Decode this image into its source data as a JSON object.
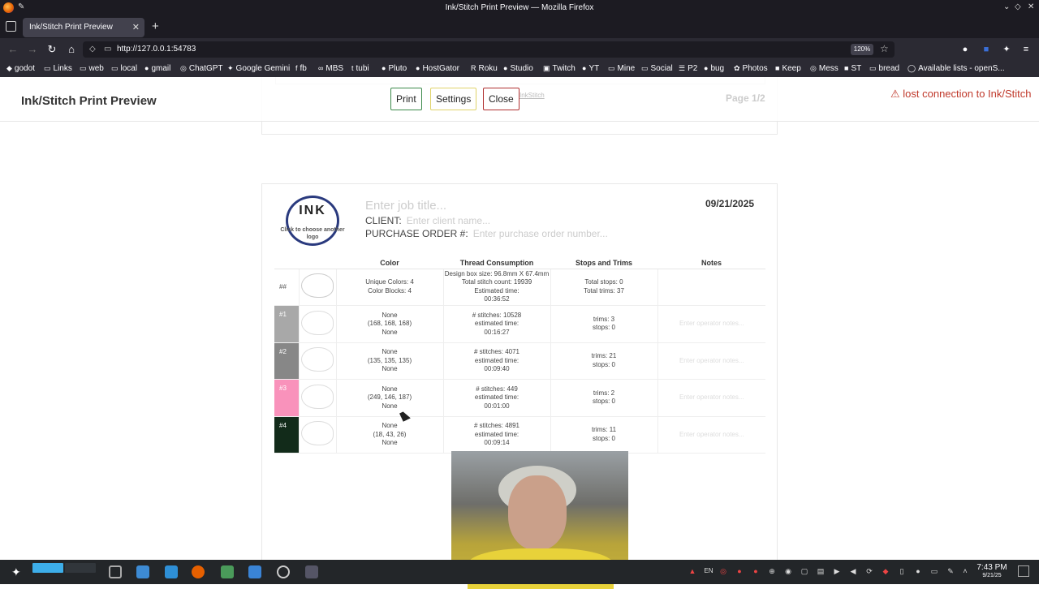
{
  "window": {
    "title": "Ink/Stitch Print Preview — Mozilla Firefox"
  },
  "tab": {
    "label": "Ink/Stitch Print Preview"
  },
  "url": {
    "value": "http://127.0.0.1:54783",
    "zoom": "120%"
  },
  "bookmarks": [
    "godot",
    "Links",
    "web",
    "local",
    "gmail",
    "ChatGPT",
    "Google Gemini",
    "fb",
    "MBS",
    "tubi",
    "Pluto",
    "HostGator",
    "Roku",
    "Studio",
    "Twitch",
    "YT",
    "Mine",
    "Social",
    "P2",
    "bug",
    "Photos",
    "Keep",
    "Mess",
    "ST",
    "bread",
    "Available lists - openS..."
  ],
  "header": {
    "title": "Ink/Stitch Print Preview",
    "print_label": "Print",
    "settings_label": "Settings",
    "close_label": "Close",
    "page_label": "Page 1/2",
    "connection_label": "⚠ lost connection to Ink/Stitch",
    "faint_link": "InkStitch"
  },
  "doc": {
    "logo_text": "INK",
    "logo_caption": "Click to choose another logo",
    "job_title_placeholder": "Enter job title...",
    "client_label": "CLIENT:",
    "client_placeholder": "Enter client name...",
    "po_label": "PURCHASE ORDER #:",
    "po_placeholder": "Enter purchase order number...",
    "date": "09/21/2025"
  },
  "table": {
    "headers": [
      "Color",
      "Thread Consumption",
      "Stops and Trims",
      "Notes"
    ],
    "summary": {
      "id": "##",
      "color": [
        "Unique Colors: 4",
        "Color Blocks: 4"
      ],
      "thread": [
        "Design box size: 96.8mm X 67.4mm",
        "Total stitch count: 19939",
        "Estimated time:",
        "00:36:52"
      ],
      "stops": [
        "Total stops: 0",
        "Total trims: 37"
      ]
    },
    "rows": [
      {
        "id": "#1",
        "swatch": "#a8a8a8",
        "color": [
          "None",
          "(168, 168, 168)",
          "None"
        ],
        "thread": [
          "# stitches: 10528",
          "estimated time:",
          "00:16:27"
        ],
        "stops": [
          "trims: 3",
          "stops: 0"
        ],
        "notes": "Enter operator notes..."
      },
      {
        "id": "#2",
        "swatch": "#878787",
        "color": [
          "None",
          "(135, 135, 135)",
          "None"
        ],
        "thread": [
          "# stitches: 4071",
          "estimated time:",
          "00:09:40"
        ],
        "stops": [
          "trims: 21",
          "stops: 0"
        ],
        "notes": "Enter operator notes..."
      },
      {
        "id": "#3",
        "swatch": "#f992bb",
        "color": [
          "None",
          "(249, 146, 187)",
          "None"
        ],
        "thread": [
          "# stitches: 449",
          "estimated time:",
          "00:01:00"
        ],
        "stops": [
          "trims: 2",
          "stops: 0"
        ],
        "notes": "Enter operator notes..."
      },
      {
        "id": "#4",
        "swatch": "#122b1a",
        "color": [
          "None",
          "(18, 43, 26)",
          "None"
        ],
        "thread": [
          "# stitches: 4891",
          "estimated time:",
          "00:09:14"
        ],
        "stops": [
          "trims: 11",
          "stops: 0"
        ],
        "notes": "Enter operator notes..."
      }
    ]
  },
  "taskbar": {
    "time": "7:43 PM",
    "date": "9/21/25",
    "lang": "EN"
  }
}
